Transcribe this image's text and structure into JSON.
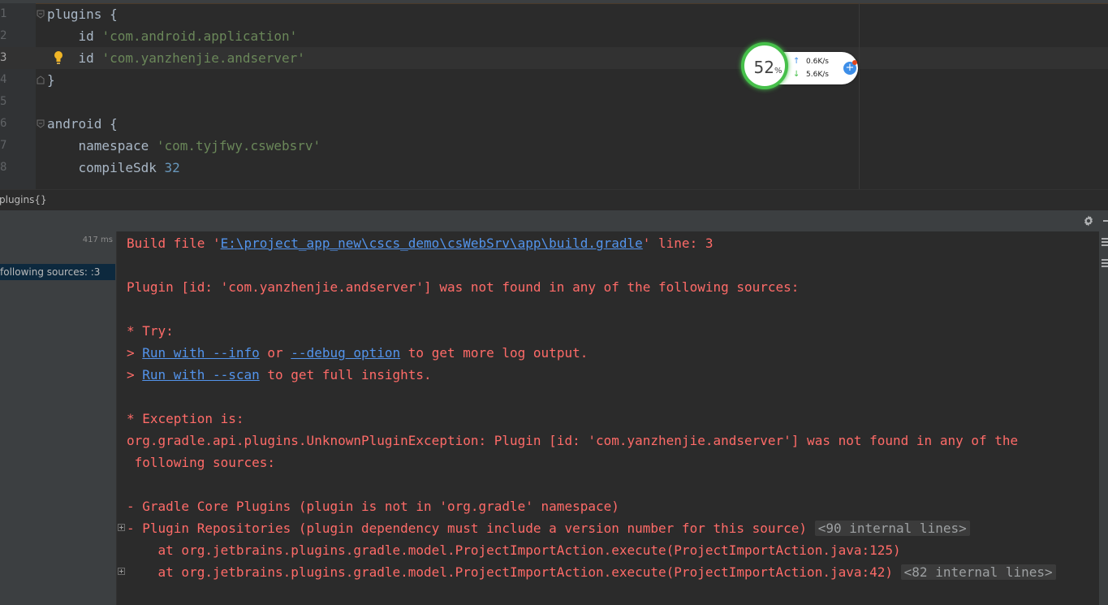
{
  "editor": {
    "lines": [
      {
        "n": "1",
        "parts": [
          {
            "t": "plugins {",
            "c": "plain"
          }
        ]
      },
      {
        "n": "2",
        "parts": [
          {
            "t": "    id ",
            "c": "plain"
          },
          {
            "t": "'com.android.application'",
            "c": "str"
          }
        ]
      },
      {
        "n": "3",
        "parts": [
          {
            "t": "    id ",
            "c": "plain"
          },
          {
            "t": "'com.yanzhenjie.andserver'",
            "c": "str"
          }
        ],
        "current": true
      },
      {
        "n": "4",
        "parts": [
          {
            "t": "}",
            "c": "plain"
          }
        ]
      },
      {
        "n": "5",
        "parts": []
      },
      {
        "n": "6",
        "parts": [
          {
            "t": "android {",
            "c": "plain"
          }
        ]
      },
      {
        "n": "7",
        "parts": [
          {
            "t": "    namespace ",
            "c": "plain"
          },
          {
            "t": "'com.tyjfwy.cswebsrv'",
            "c": "str"
          }
        ]
      },
      {
        "n": "8",
        "parts": [
          {
            "t": "    compileSdk ",
            "c": "plain"
          },
          {
            "t": "32",
            "c": "num"
          }
        ]
      }
    ]
  },
  "net_widget": {
    "percent": "52",
    "percent_sign": "%",
    "upload": "0.6K/s",
    "download": "5.6K/s",
    "up_arrow": "↑",
    "down_arrow": "↓",
    "plus": "+",
    "ring_color": "#46c04a"
  },
  "breadcrumb": {
    "text": "plugins{}"
  },
  "build_tree": {
    "duration": "417 ms",
    "selected_item": "following sources: :3"
  },
  "console": {
    "line1_prefix": "Build file '",
    "line1_link": "E:\\project_app_new\\cscs_demo\\csWebSrv\\app\\build.gradle",
    "line1_suffix": "' line: 3",
    "line2": "Plugin [id: 'com.yanzhenjie.andserver'] was not found in any of the following sources:",
    "try_header": "* Try:",
    "try1_prefix": "> ",
    "try1_link1": "Run with --info",
    "try1_mid": " or ",
    "try1_link2": "--debug option",
    "try1_suffix": " to get more log output.",
    "try2_prefix": "> ",
    "try2_link": "Run with --scan",
    "try2_suffix": " to get full insights.",
    "exception_header": "* Exception is:",
    "exception_line1": "org.gradle.api.plugins.UnknownPluginException: Plugin [id: 'com.yanzhenjie.andserver'] was not found in any of the",
    "exception_line2": " following sources:",
    "source1": "- Gradle Core Plugins (plugin is not in 'org.gradle' namespace)",
    "source2": "- Plugin Repositories (plugin dependency must include a version number for this source)",
    "fold1": "<90 internal lines>",
    "stack1": "    at org.jetbrains.plugins.gradle.model.ProjectImportAction.execute(ProjectImportAction.java:125)",
    "stack2": "    at org.jetbrains.plugins.gradle.model.ProjectImportAction.execute(ProjectImportAction.java:42)",
    "fold2": "<82 internal lines>"
  },
  "colors": {
    "error_text": "#ff6b68",
    "link": "#5394ec",
    "editor_bg": "#2b2b2b",
    "panel_bg": "#3c3f41"
  }
}
